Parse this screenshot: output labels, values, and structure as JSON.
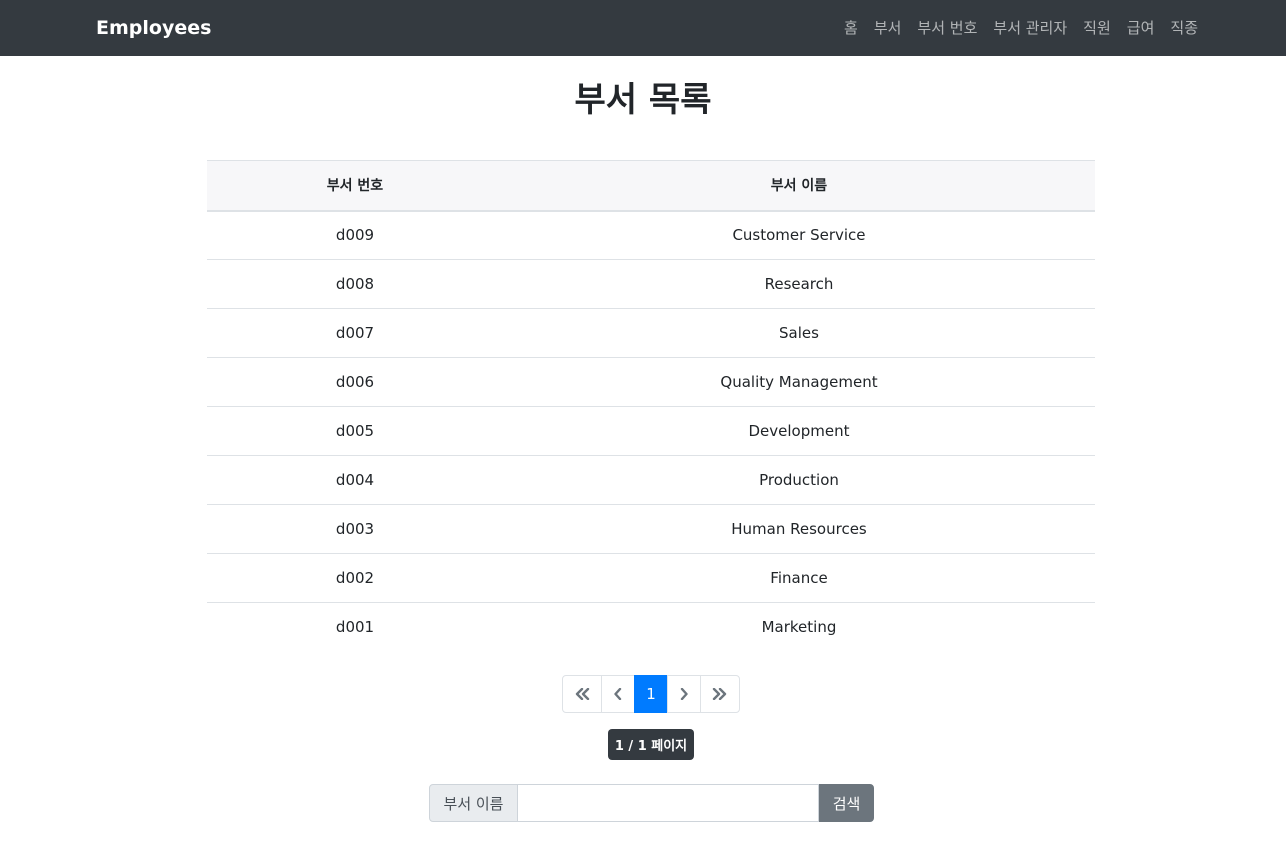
{
  "navbar": {
    "brand": "Employees",
    "links": [
      "홈",
      "부서",
      "부서 번호",
      "부서 관리자",
      "직원",
      "급여",
      "직종"
    ]
  },
  "page_title": "부서 목록",
  "table": {
    "headers": [
      "부서 번호",
      "부서 이름"
    ],
    "rows": [
      [
        "d009",
        "Customer Service"
      ],
      [
        "d008",
        "Research"
      ],
      [
        "d007",
        "Sales"
      ],
      [
        "d006",
        "Quality Management"
      ],
      [
        "d005",
        "Development"
      ],
      [
        "d004",
        "Production"
      ],
      [
        "d003",
        "Human Resources"
      ],
      [
        "d002",
        "Finance"
      ],
      [
        "d001",
        "Marketing"
      ]
    ]
  },
  "pagination": {
    "current_page": "1",
    "icons": [
      "double-chevron-left-icon",
      "chevron-left-icon",
      "chevron-right-icon",
      "double-chevron-right-icon"
    ],
    "active_color": "#007bff"
  },
  "page_info": "1 / 1 페이지",
  "search": {
    "label": "부서 이름",
    "value": "",
    "button_label": "검색"
  },
  "colors": {
    "navbar_bg": "#343a40",
    "search_button_bg": "#6c757d"
  }
}
